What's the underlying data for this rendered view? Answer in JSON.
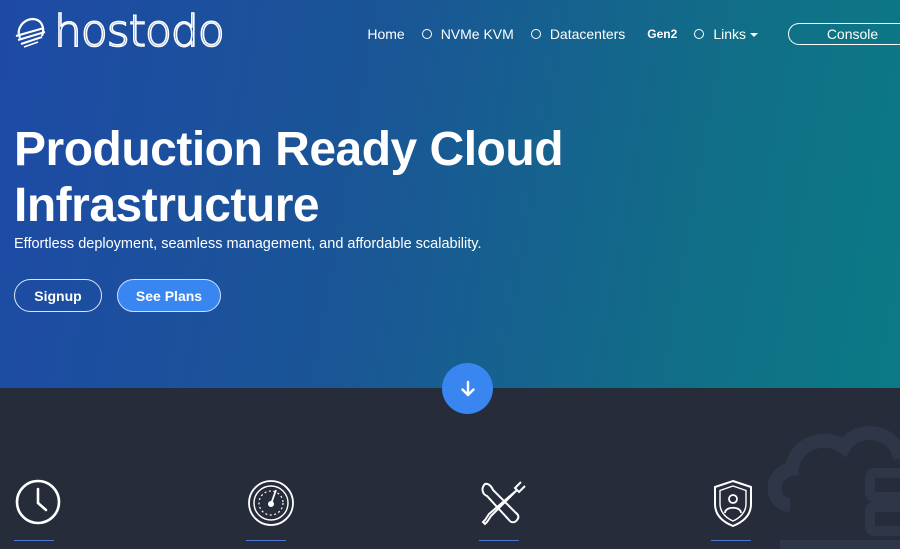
{
  "brand": {
    "name": "hostodo"
  },
  "nav": {
    "items": [
      {
        "label": "Home"
      },
      {
        "label": "NVMe KVM"
      },
      {
        "label": "Datacenters"
      },
      {
        "label": "Gen2"
      },
      {
        "label": "Links"
      }
    ],
    "console_label": "Console"
  },
  "hero": {
    "headline_line1": "Production Ready Cloud",
    "headline_line2": "Infrastructure",
    "subline": "Effortless deployment, seamless management, and affordable scalability.",
    "signup_label": "Signup",
    "plans_label": "See Plans"
  },
  "features": [
    {
      "icon": "clock-icon"
    },
    {
      "icon": "speedometer-icon"
    },
    {
      "icon": "tools-icon"
    },
    {
      "icon": "shield-user-icon"
    }
  ],
  "colors": {
    "accent": "#3a86f0",
    "dark_bg": "#262c3a",
    "hero_start": "#1e4aa6",
    "hero_end": "#0b7a86"
  }
}
